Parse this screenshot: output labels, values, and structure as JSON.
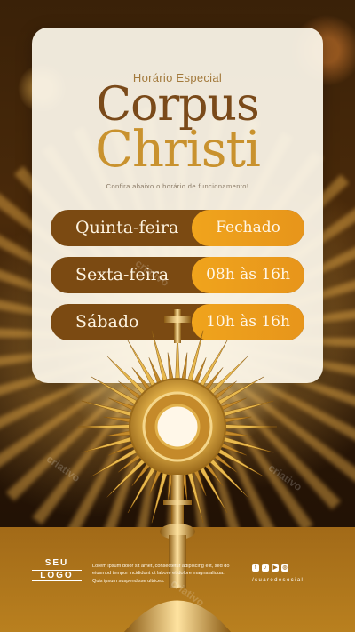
{
  "header": {
    "kicker": "Horário Especial",
    "title_line1": "Corpus",
    "title_line2": "Christi",
    "subtitle": "Confira abaixo o horário de funcionamento!"
  },
  "schedule": [
    {
      "day": "Quinta-feira",
      "hours": "Fechado"
    },
    {
      "day": "Sexta-feira",
      "hours": "08h às 16h"
    },
    {
      "day": "Sábado",
      "hours": "10h às 16h"
    }
  ],
  "footer": {
    "logo_line1": "SEU",
    "logo_line2": "LOGO",
    "lorem": "Lorem ipsum dolor sit amet, consectetur adipiscing elit, sed do eiusmod tempor incididunt ut labore et dolore magna aliqua. Quis ipsum suspendisse ultrices.",
    "social_icons": [
      "facebook-icon",
      "tiktok-icon",
      "youtube-icon",
      "instagram-icon"
    ],
    "handle": "/suaredesocial"
  },
  "watermark": "criativo",
  "colors": {
    "brown": "#7b4a12",
    "gold": "#f0a41c",
    "title_dark": "#7a4a1a",
    "title_gold": "#c9922e",
    "footer": "#b07620"
  }
}
